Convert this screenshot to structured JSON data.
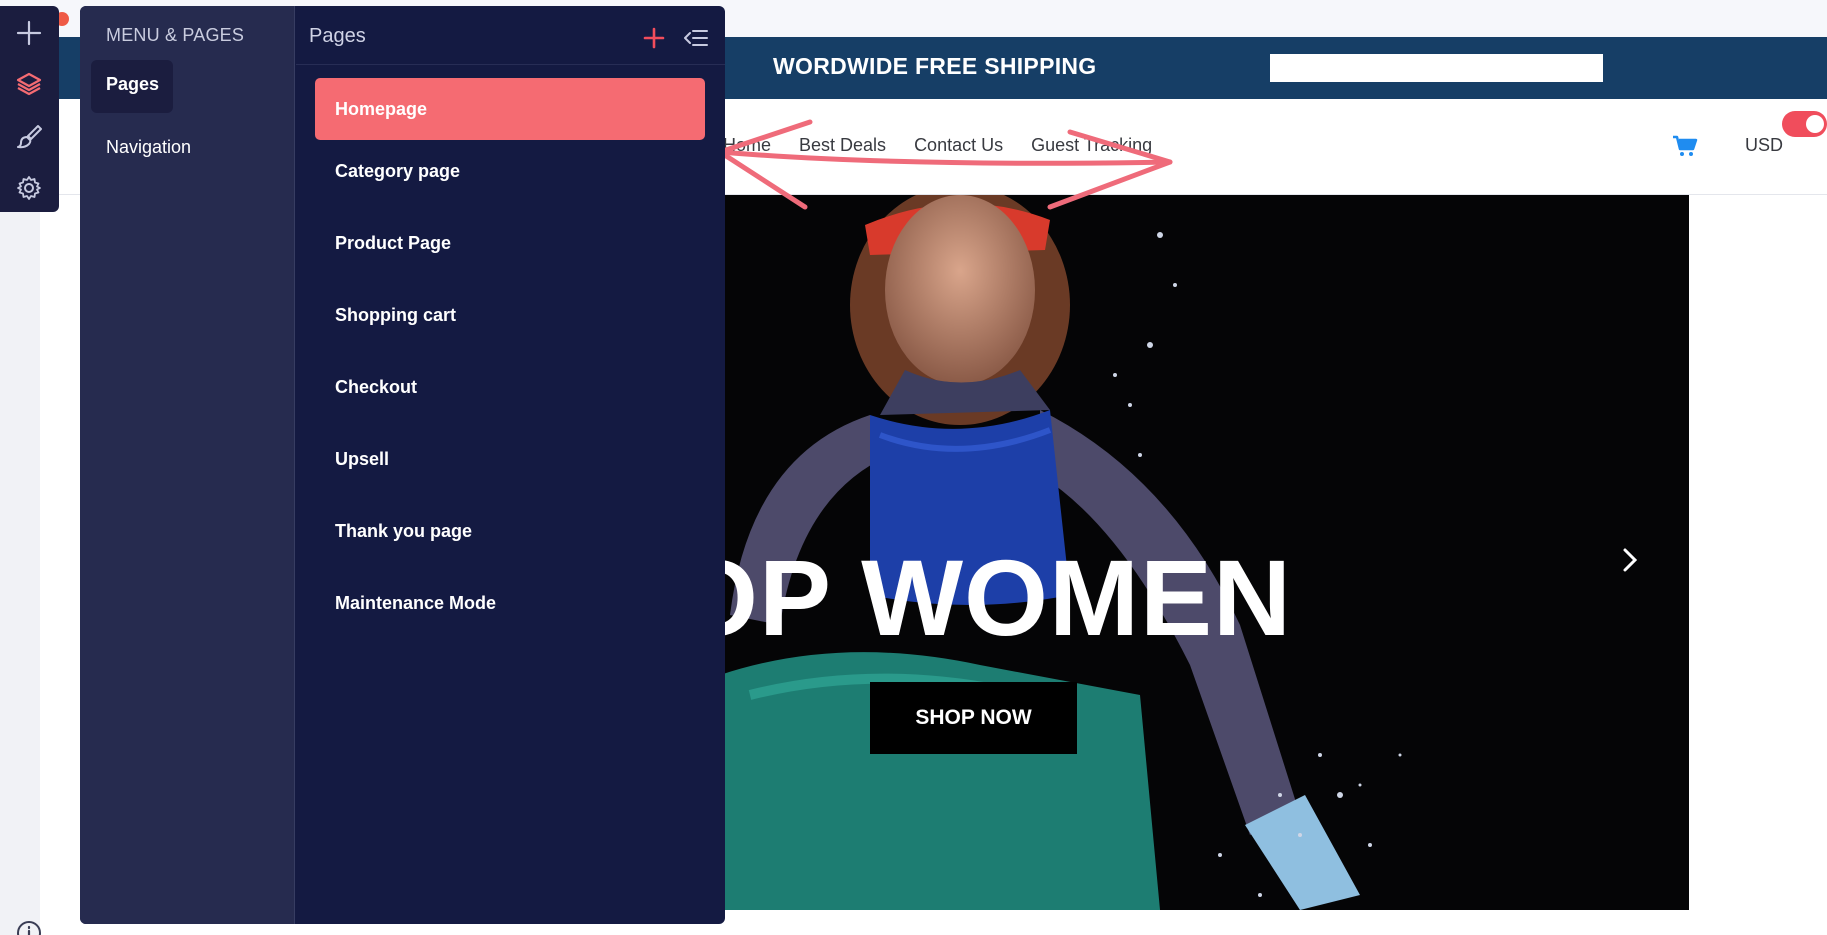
{
  "editor": {
    "panel_title": "MENU & PAGES",
    "menu_items": [
      "Pages",
      "Navigation"
    ],
    "tooltip": "Pages",
    "pages_title": "Pages",
    "pages": [
      "Homepage",
      "Category page",
      "Product Page",
      "Shopping cart",
      "Checkout",
      "Upsell",
      "Thank you page",
      "Maintenance Mode"
    ],
    "active_page": "Homepage",
    "rail_icons": [
      "plus-icon",
      "layers-icon",
      "brush-icon",
      "settings-icon"
    ],
    "accent_color": "#f56b72",
    "panel_color": "#141a42"
  },
  "site": {
    "promo_text": "WORDWIDE FREE SHIPPING",
    "nav_links": [
      "Home",
      "Best Deals",
      "Contact Us",
      "Guest Tracking"
    ],
    "currency": "USD",
    "hero_text": "OP WOMEN",
    "cta_label": "SHOP NOW",
    "promo_bar_color": "#163e66"
  }
}
